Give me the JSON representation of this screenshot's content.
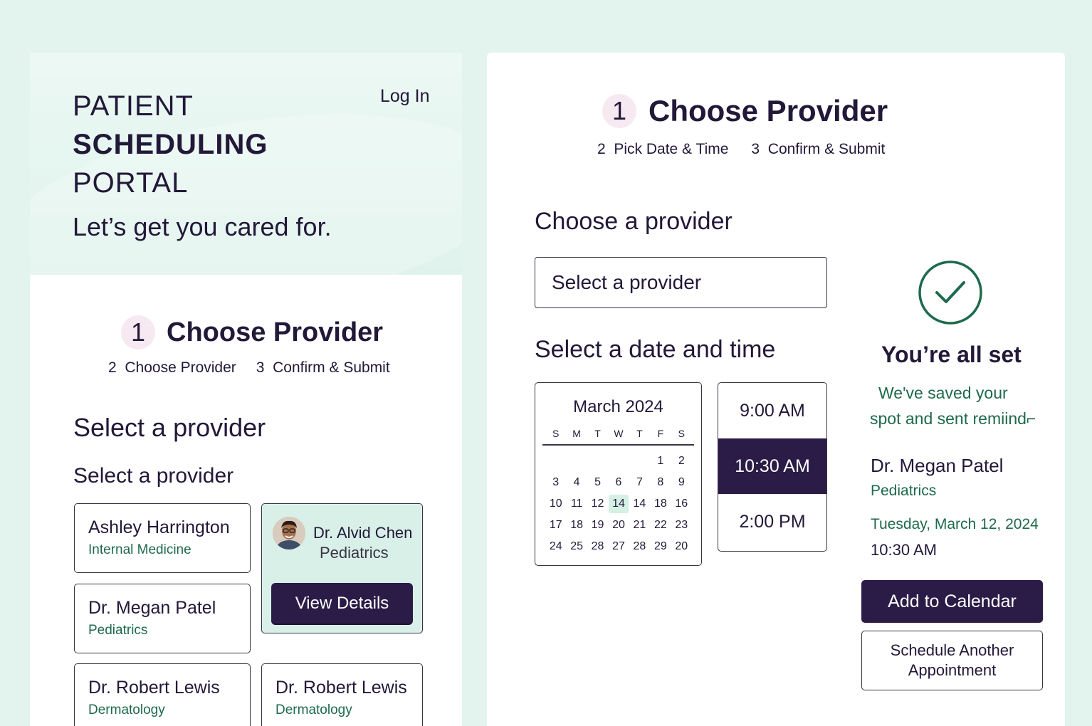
{
  "left": {
    "portal_title": [
      "PATIENT",
      "SCHEDULING",
      "PORTAL"
    ],
    "login": "Log In",
    "tagline": "Let’s get you cared for.",
    "step_number": "1",
    "step_title": "Choose Provider",
    "steps": [
      {
        "num": "2",
        "label": "Choose Provider"
      },
      {
        "num": "3",
        "label": "Confirm & Submit"
      }
    ],
    "heading": "Select a provider",
    "subheading": "Select a provider",
    "providers": [
      {
        "name": "Ashley Harrington",
        "specialty": "Internal Medicine"
      },
      {
        "name": "Dr. Megan Patel",
        "specialty": "Pediatrics"
      },
      {
        "name": "Dr. Robert Lewis",
        "specialty": "Dermatology"
      },
      {
        "name": "Dr. Robert Lewis",
        "specialty": "Dermatology"
      }
    ],
    "featured": {
      "name": "Dr. Alvid Chen",
      "specialty": "Pediatrics",
      "button": "View Details"
    }
  },
  "right": {
    "step_number": "1",
    "step_title": "Choose Provider",
    "steps": [
      {
        "num": "2",
        "label": "Pick Date & Time"
      },
      {
        "num": "3",
        "label": "Confirm & Submit"
      }
    ],
    "choose_heading": "Choose a provider",
    "select_placeholder": "Select a provider",
    "date_heading": "Select a date and time",
    "calendar": {
      "month": "March 2024",
      "weekdays": [
        "S",
        "M",
        "T",
        "W",
        "T",
        "F",
        "S"
      ],
      "days": [
        "",
        "",
        "",
        "",
        "",
        "1",
        "2",
        "3",
        "4",
        "5",
        "6",
        "7",
        "8",
        "9",
        "10",
        "11",
        "12",
        "14",
        "14",
        "18",
        "16",
        "17",
        "18",
        "19",
        "20",
        "21",
        "22",
        "23",
        "24",
        "25",
        "28",
        "27",
        "28",
        "29",
        "20"
      ],
      "highlighted_index": 17
    },
    "times": [
      "9:00 AM",
      "10:30 AM",
      "2:00 PM"
    ],
    "selected_time_index": 1,
    "confirmation": {
      "title": "You’re all set",
      "message_lines": [
        "We've saved your",
        "spot and sent remiind⌐"
      ],
      "provider": "Dr. Megan Patel",
      "specialty": "Pediatrics",
      "date": "Tuesday, March 12, 2024",
      "time": "10:30 AM",
      "add_calendar": "Add to Calendar",
      "schedule_another": "Schedule Another Appointment"
    }
  },
  "colors": {
    "background": "#e3f4ef",
    "primary": "#2a1c46",
    "accent_green": "#1e6a4c",
    "step_badge": "#f7e9f1",
    "highlight": "#d8f0e8"
  }
}
